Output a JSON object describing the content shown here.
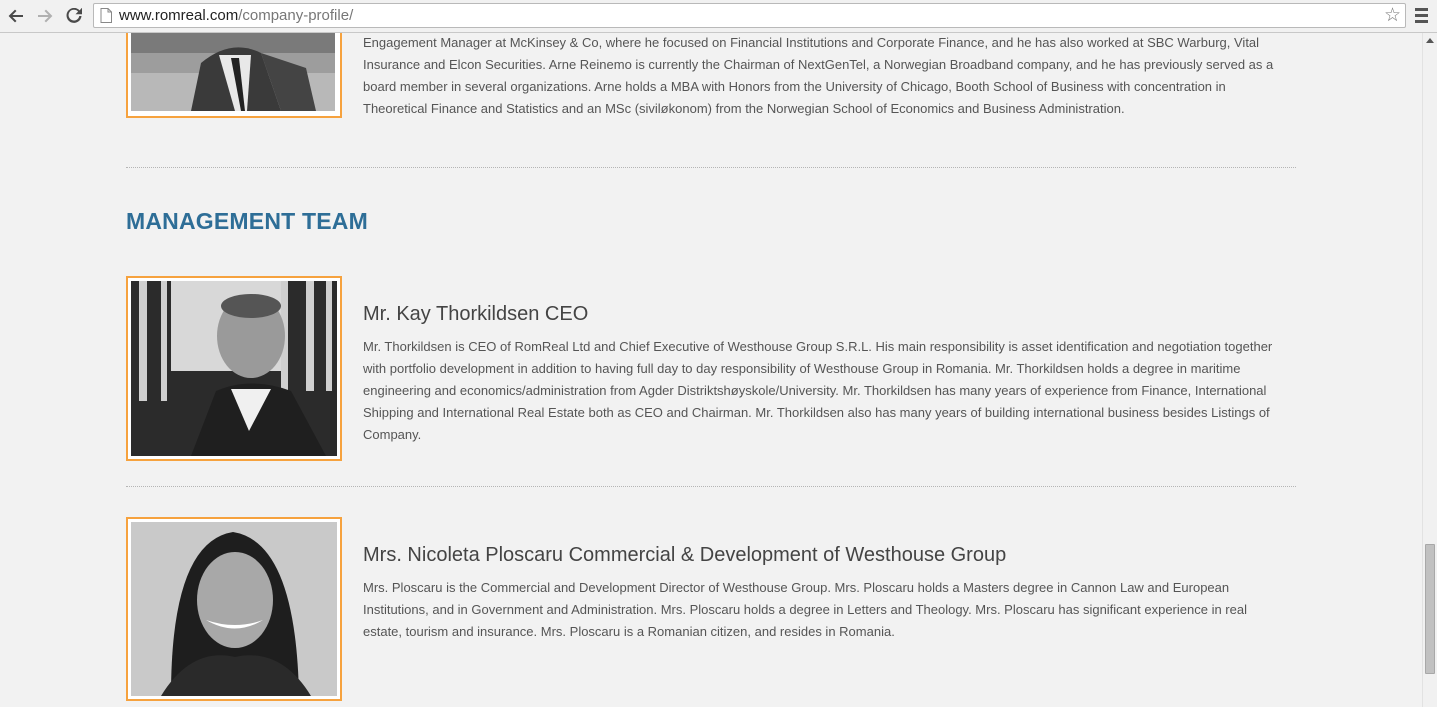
{
  "browser": {
    "url_domain": "www.romreal.com",
    "url_path": "/company-profile/"
  },
  "top_bio": {
    "partial_text": "Engagement Manager at McKinsey & Co, where he focused on Financial Institutions and Corporate Finance, and he has also worked at SBC Warburg, Vital Insurance and Elcon Securities. Arne Reinemo is currently the Chairman of NextGenTel, a Norwegian Broadband company, and he has previously served as a board member in several organizations. Arne holds a MBA with Honors from the University of Chicago, Booth School of Business with concentration in Theoretical Finance and Statistics and an MSc (siviløkonom) from the Norwegian School of Economics and Business Administration."
  },
  "section": {
    "title": "MANAGEMENT TEAM"
  },
  "team": [
    {
      "name": "Mr. Kay Thorkildsen CEO",
      "bio": "Mr. Thorkildsen is CEO of RomReal Ltd and Chief Executive of Westhouse Group S.R.L. His main responsibility is asset identification and negotiation together with portfolio development in addition to having full day to day responsibility of Westhouse Group in Romania. Mr. Thorkildsen holds a degree in maritime engineering and economics/administration from Agder Distriktshøyskole/University. Mr. Thorkildsen has many years of experience from Finance, International Shipping and International Real Estate both as CEO and Chairman. Mr. Thorkildsen also has many years of building international business besides Listings of Company."
    },
    {
      "name": "Mrs. Nicoleta Ploscaru Commercial & Development of Westhouse Group",
      "bio": "Mrs. Ploscaru is the Commercial and Development Director of Westhouse Group. Mrs. Ploscaru holds a Masters degree in Cannon Law and European Institutions, and in Government and Administration. Mrs. Ploscaru holds a degree in Letters and Theology. Mrs. Ploscaru has significant experience in real estate, tourism and insurance. Mrs. Ploscaru is a Romanian citizen, and resides in Romania."
    }
  ],
  "colors": {
    "accent_orange": "#f6a23e",
    "heading_blue": "#2e6e97",
    "page_bg": "#f2f2f2"
  },
  "icons": {
    "back": "arrow-left-icon",
    "forward": "arrow-right-icon",
    "reload": "reload-icon",
    "page": "page-icon",
    "bookmark": "star-icon",
    "menu": "hamburger-menu-icon"
  }
}
